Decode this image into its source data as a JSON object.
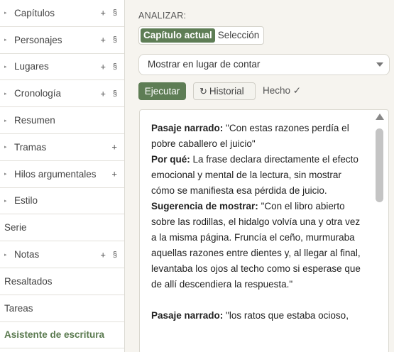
{
  "sidebar": {
    "items": [
      {
        "label": "Capítulos",
        "caret": "▸",
        "plus": "+",
        "section": "§"
      },
      {
        "label": "Personajes",
        "caret": "▸",
        "plus": "+",
        "section": "§"
      },
      {
        "label": "Lugares",
        "caret": "▸",
        "plus": "+",
        "section": "§"
      },
      {
        "label": "Cronología",
        "caret": "▸",
        "plus": "+",
        "section": "§"
      },
      {
        "label": "Resumen",
        "caret": "▸"
      },
      {
        "label": "Tramas",
        "caret": "▸",
        "plus": "+"
      },
      {
        "label": "Hilos argumentales",
        "caret": "▸",
        "plus": "+"
      },
      {
        "label": "Estilo",
        "caret": "▸"
      },
      {
        "label": "Serie"
      },
      {
        "label": "Notas",
        "caret": "▸",
        "plus": "+",
        "section": "§"
      },
      {
        "label": "Resaltados"
      },
      {
        "label": "Tareas"
      },
      {
        "label": "Asistente de escritura"
      }
    ]
  },
  "main": {
    "analyze_label": "ANALIZAR:",
    "scope": {
      "current": "Capítulo actual",
      "selection": "Selección"
    },
    "mode_select": "Mostrar en lugar de contar",
    "run_button": "Ejecutar",
    "history_icon": "↻",
    "history_button": "Historial",
    "status": "Hecho ✓",
    "output": {
      "p1_h1": "Pasaje narrado:",
      "p1_t1": " \"Con estas razones perdía el pobre caballero el juicio\"",
      "p1_h2": "Por qué:",
      "p1_t2": " La frase declara directamente el efecto emocional y mental de la lectura, sin mostrar cómo se manifiesta esa pérdida de juicio.",
      "p1_h3": "Sugerencia de mostrar:",
      "p1_t3": " \"Con el libro abierto sobre las rodillas, el hidalgo volvía una y otra vez a la misma página. Fruncía el ceño, murmuraba aquellas razones entre dientes y, al llegar al final, levantaba los ojos al techo como si esperase que de allí descendiera la respuesta.\"",
      "p2_h1": "Pasaje narrado:",
      "p2_t1": " \"los ratos que estaba ocioso,"
    }
  },
  "colors": {
    "accent": "#5e7d55",
    "active_item": "#5a7a4f"
  }
}
